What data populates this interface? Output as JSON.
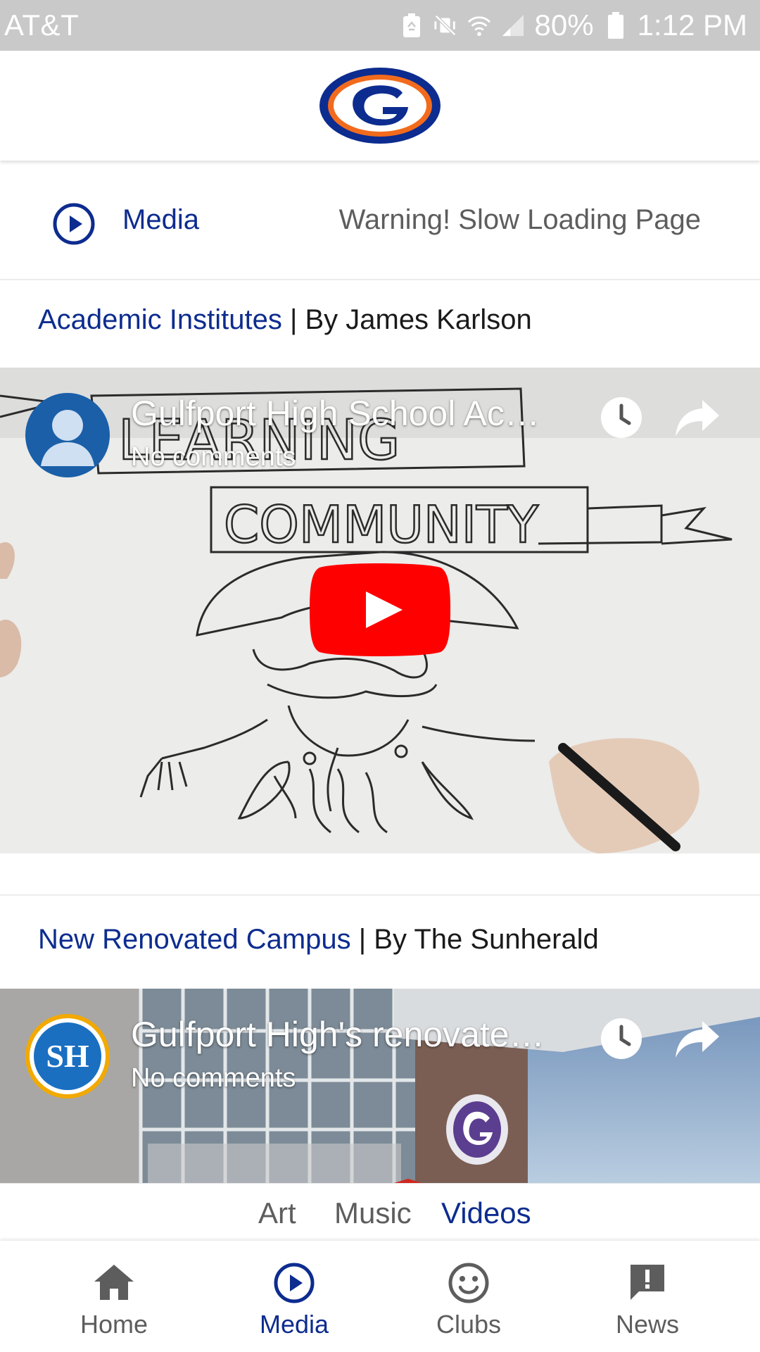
{
  "status_bar": {
    "carrier": "AT&T",
    "battery": "80%",
    "time": "1:12 PM"
  },
  "header": {
    "logo_letter": "G"
  },
  "section": {
    "title": "Media",
    "warning": "Warning! Slow Loading Page"
  },
  "posts": [
    {
      "link_text": "Academic Institutes",
      "separator": " | ",
      "byline": "By James Karlson",
      "video": {
        "title": "Gulfport High School Ac…",
        "subtitle": "No comments",
        "thumb_text_1": "LEARNING",
        "thumb_text_2": "COMMUNITY"
      }
    },
    {
      "link_text": "New Renovated Campus",
      "separator": " | ",
      "byline": "By The Sunherald",
      "video": {
        "title": "Gulfport High's renovate…",
        "subtitle": "No comments",
        "channel_initials": "SH"
      }
    }
  ],
  "sub_tabs": [
    {
      "label": "Art",
      "active": false
    },
    {
      "label": "Music",
      "active": false
    },
    {
      "label": "Videos",
      "active": true
    }
  ],
  "bottom_nav": [
    {
      "label": "Home",
      "icon": "home-icon",
      "active": false
    },
    {
      "label": "Media",
      "icon": "play-circle-icon",
      "active": true
    },
    {
      "label": "Clubs",
      "icon": "smiley-icon",
      "active": false
    },
    {
      "label": "News",
      "icon": "message-alert-icon",
      "active": false
    }
  ],
  "colors": {
    "brand_blue": "#0d2c8f",
    "brand_orange": "#f26b1d",
    "youtube_red": "#ff0000"
  }
}
